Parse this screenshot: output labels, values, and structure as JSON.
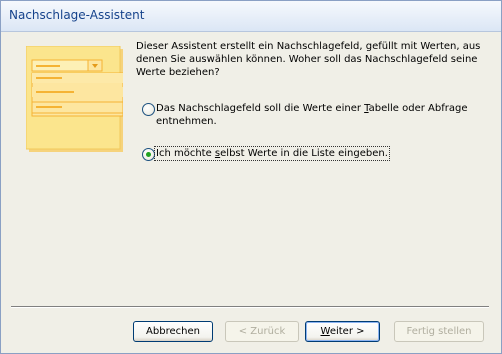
{
  "window": {
    "title": "Nachschlage-Assistent"
  },
  "intro_text": "Dieser Assistent erstellt ein Nachschlagefeld, gefüllt mit Werten, aus denen Sie auswählen können. Woher soll das Nachschlagefeld seine Werte beziehen?",
  "options": [
    {
      "label_before": "Das Nachschlagefeld soll die Werte einer ",
      "mnemonic": "T",
      "label_after": "abelle oder Abfrage entnehmen.",
      "selected": false
    },
    {
      "label_before": "Ich möchte ",
      "mnemonic": "s",
      "label_after": "elbst Werte in die Liste eingeben.",
      "selected": true
    }
  ],
  "buttons": {
    "cancel": {
      "label": "Abbrechen",
      "enabled": true
    },
    "back": {
      "label": "< Zurück",
      "enabled": false
    },
    "next": {
      "label_before": "",
      "mnemonic": "W",
      "label_after": "eiter >",
      "enabled": true
    },
    "finish": {
      "label": "Fertig stellen",
      "enabled": false
    }
  },
  "colors": {
    "title_text": "#15428b",
    "illustration_yellow": "#fbe58d",
    "illustration_orange": "#f5b334",
    "radio_dot": "#21a121"
  },
  "icons": [
    "lookup-wizard-illustration",
    "dropdown-arrow-icon"
  ]
}
